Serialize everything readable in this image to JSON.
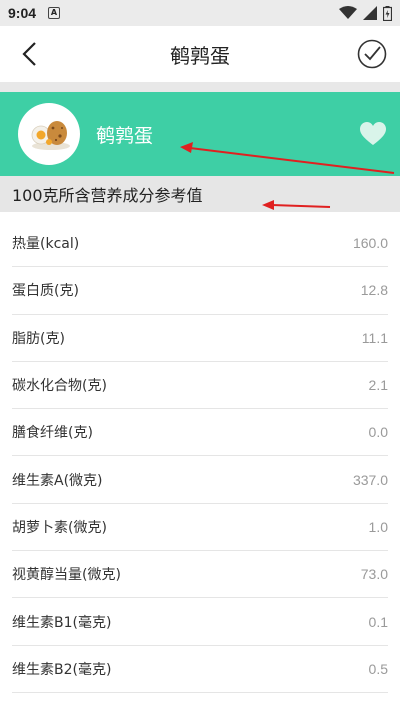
{
  "status_bar": {
    "time": "9:04",
    "notification_icon_letter": "A"
  },
  "header": {
    "title": "鹌鹑蛋"
  },
  "banner": {
    "name": "鹌鹑蛋",
    "background": "#3ecfa5"
  },
  "section": {
    "title": "100克所含营养成分参考值"
  },
  "nutrients": [
    {
      "label": "热量(kcal)",
      "value": "160.0"
    },
    {
      "label": "蛋白质(克)",
      "value": "12.8"
    },
    {
      "label": "脂肪(克)",
      "value": "11.1"
    },
    {
      "label": "碳水化合物(克)",
      "value": "2.1"
    },
    {
      "label": "膳食纤维(克)",
      "value": "0.0"
    },
    {
      "label": "维生素A(微克)",
      "value": "337.0"
    },
    {
      "label": "胡萝卜素(微克)",
      "value": "1.0"
    },
    {
      "label": "视黄醇当量(微克)",
      "value": "73.0"
    },
    {
      "label": "维生素B1(毫克)",
      "value": "0.1"
    },
    {
      "label": "维生素B2(毫克)",
      "value": "0.5"
    }
  ],
  "colors": {
    "accent_green": "#3ecfa5",
    "annotation_arrow": "#e02020"
  },
  "icons": [
    "back-arrow-icon",
    "check-circle-icon",
    "heart-icon",
    "egg-icon",
    "wifi-icon",
    "signal-icon",
    "battery-icon"
  ]
}
